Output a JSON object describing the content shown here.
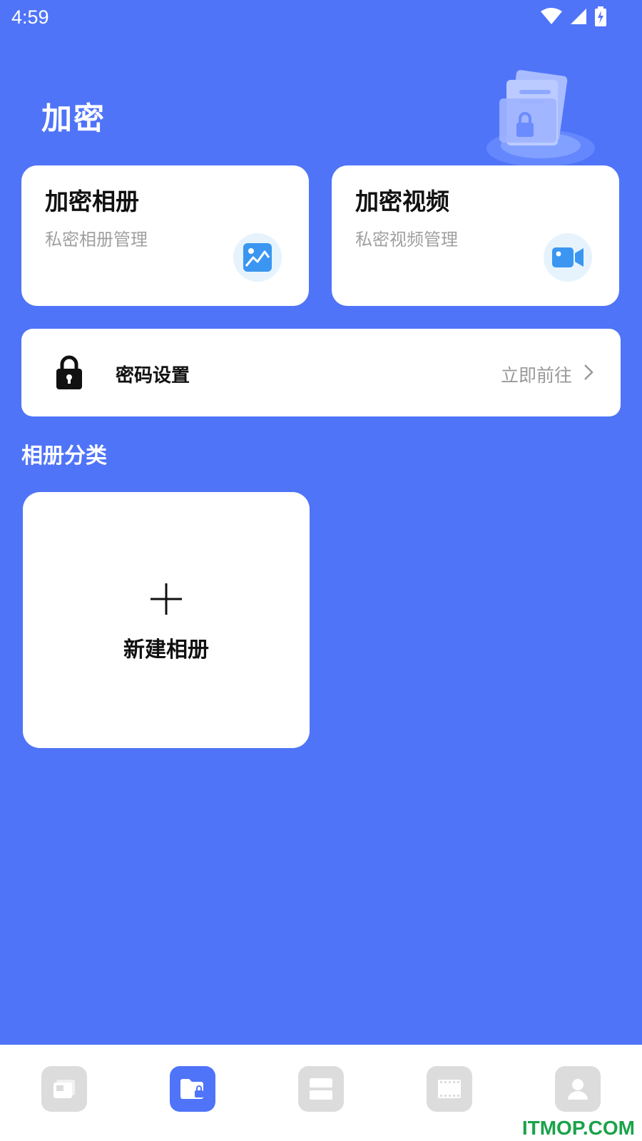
{
  "status": {
    "time": "4:59"
  },
  "header": {
    "title": "加密"
  },
  "cards": {
    "album": {
      "title": "加密相册",
      "subtitle": "私密相册管理"
    },
    "video": {
      "title": "加密视频",
      "subtitle": "私密视频管理"
    }
  },
  "password": {
    "label": "密码设置",
    "action": "立即前往"
  },
  "albums": {
    "section_title": "相册分类",
    "new_label": "新建相册"
  },
  "nav": {
    "items": [
      {
        "icon": "gallery-icon",
        "active": false
      },
      {
        "icon": "encrypted-folder-icon",
        "active": true
      },
      {
        "icon": "list-icon",
        "active": false
      },
      {
        "icon": "film-icon",
        "active": false
      },
      {
        "icon": "profile-icon",
        "active": false
      }
    ]
  },
  "watermark": "ITMOP.COM",
  "colors": {
    "background": "#4f74f8",
    "accent": "#4f74f8",
    "nav_inactive": "#dcdcdc"
  }
}
